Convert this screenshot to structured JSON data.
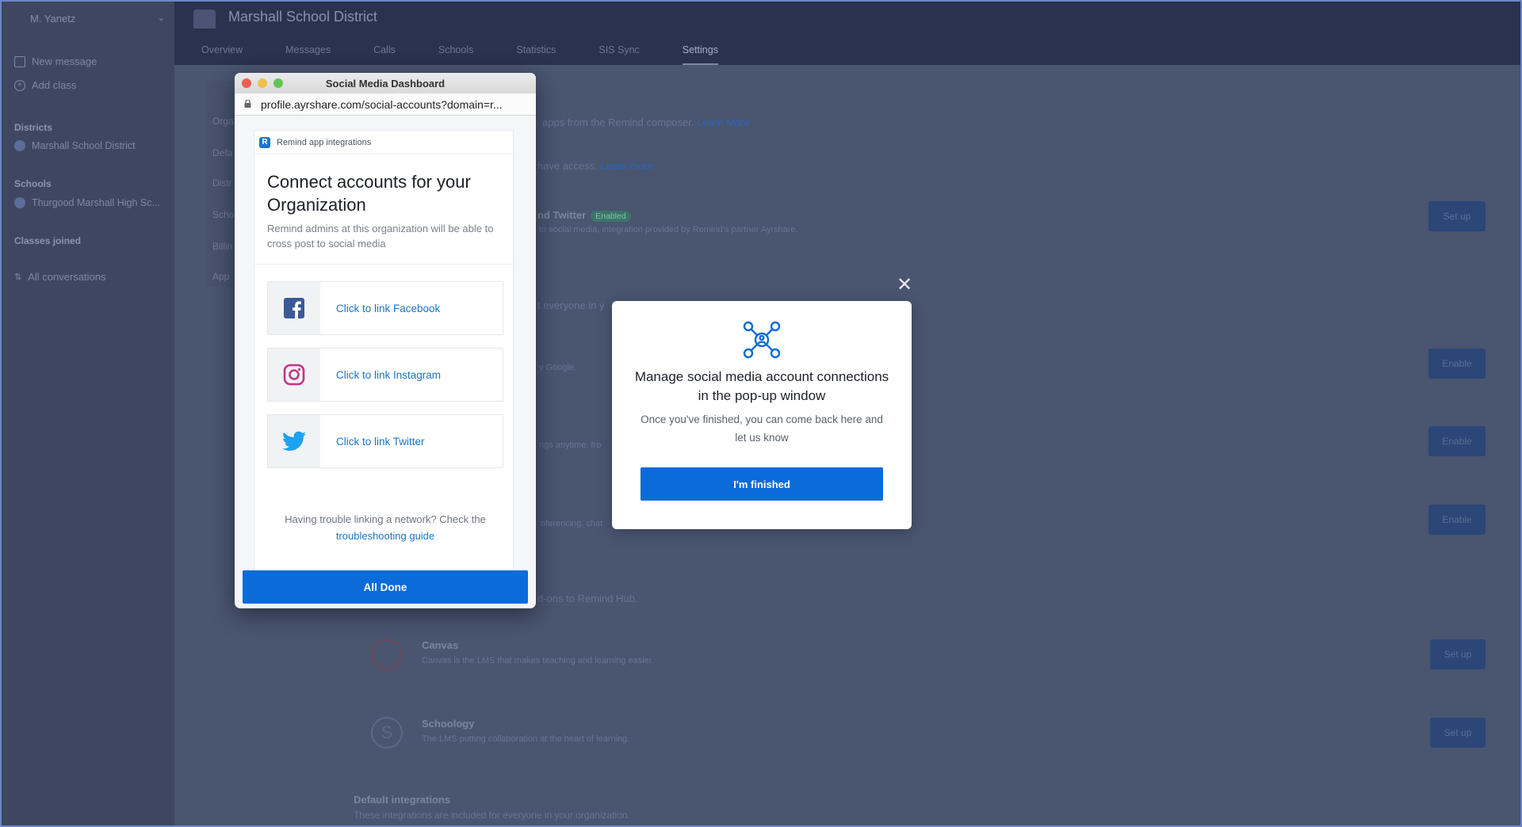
{
  "sidebar": {
    "user": "M. Yanetz",
    "new_message": "New message",
    "add_class": "Add class",
    "districts_heading": "Districts",
    "district_name": "Marshall School District",
    "schools_heading": "Schools",
    "school_name": "Thurgood Marshall High Sc...",
    "classes_heading": "Classes joined",
    "all_conversations": "All conversations"
  },
  "header": {
    "title": "Marshall School District",
    "tabs": [
      "Overview",
      "Messages",
      "Calls",
      "Schools",
      "Statistics",
      "SIS Sync",
      "Settings"
    ],
    "active_tab": "Settings"
  },
  "subnav": [
    "Orga",
    "Defa",
    "Distr",
    "Scho",
    "Billin",
    "App"
  ],
  "background": {
    "composer_text": "apps from the Remind composer.",
    "learn_more_1": "Learn More",
    "access_text": "have access.",
    "learn_more_2": "Learn more",
    "twitter_title": "nd Twitter",
    "enabled_badge": "Enabled",
    "twitter_desc": "to social media, integration provided by Remind's partner Ayrshare.",
    "everyone_text": "t everyone in y",
    "google_text": "y Google.",
    "anytime_text": "ngs anytime, fro",
    "conferencing_text": "nferencing, chat",
    "addons_text": "d-ons to Remind Hub.",
    "canvas_title": "Canvas",
    "canvas_desc": "Canvas is the LMS that makes teaching and learning easier.",
    "schoology_title": "Schoology",
    "schoology_desc": "The LMS putting collaboration at the heart of learning.",
    "default_title": "Default integrations",
    "default_desc": "These integrations are included for everyone in your organization.",
    "setup_label": "Set up",
    "enable_label": "Enable"
  },
  "popup": {
    "window_title": "Social Media Dashboard",
    "url": "profile.ayrshare.com/social-accounts?domain=r...",
    "card_header": "Remind app integrations",
    "connect_title": "Connect accounts for your Organization",
    "connect_desc": "Remind admins at this organization will be able to cross post to social media",
    "links": [
      {
        "label": "Click to link Facebook",
        "icon": "facebook-icon"
      },
      {
        "label": "Click to link Instagram",
        "icon": "instagram-icon"
      },
      {
        "label": "Click to link Twitter",
        "icon": "twitter-icon"
      }
    ],
    "trouble_text": "Having trouble linking a network? Check the",
    "trouble_link": "troubleshooting guide",
    "all_done": "All Done"
  },
  "modal": {
    "title": "Manage social media account connections in the pop-up window",
    "desc": "Once you've finished, you can come back here and let us know",
    "button": "I'm finished",
    "icon": "network-hub-icon",
    "close_icon": "close-icon"
  },
  "colors": {
    "primary": "#0b6bd8",
    "link": "#1a73c8",
    "facebook": "#3b5998",
    "instagram": "#c13584",
    "twitter": "#1da1f2"
  }
}
